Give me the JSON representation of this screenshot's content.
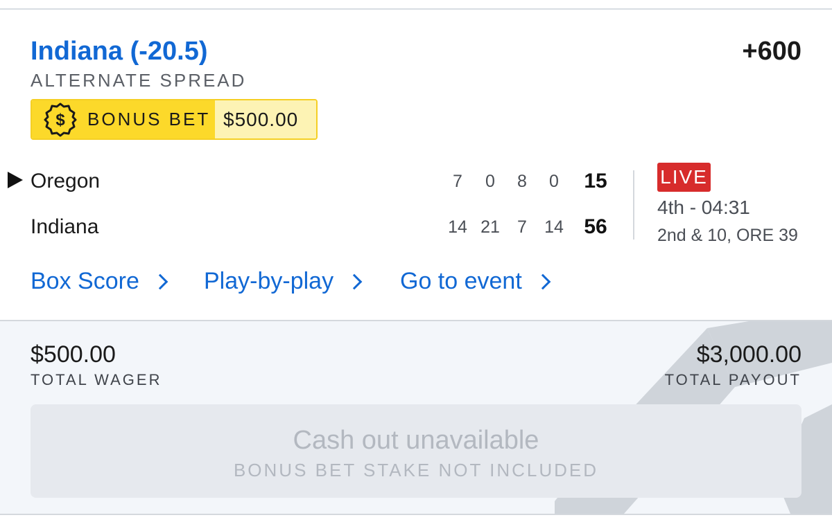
{
  "bet": {
    "selection": "Indiana (-20.5)",
    "odds": "+600",
    "market": "ALTERNATE SPREAD",
    "bonus_label": "BONUS BET",
    "bonus_amount": "$500.00"
  },
  "scoreboard": {
    "teams": [
      {
        "name": "Oregon",
        "quarters": [
          "7",
          "0",
          "8",
          "0"
        ],
        "total": "15"
      },
      {
        "name": "Indiana",
        "quarters": [
          "14",
          "21",
          "7",
          "14"
        ],
        "total": "56"
      }
    ],
    "status": {
      "live_label": "LIVE",
      "clock": "4th - 04:31",
      "situation": "2nd & 10, ORE 39"
    }
  },
  "links": {
    "box_score": "Box Score",
    "play_by_play": "Play-by-play",
    "go_to_event": "Go to event"
  },
  "summary": {
    "total_wager": "$500.00",
    "total_wager_label": "TOTAL WAGER",
    "total_payout": "$3,000.00",
    "total_payout_label": "TOTAL PAYOUT"
  },
  "cashout": {
    "title": "Cash out unavailable",
    "subtitle": "BONUS BET STAKE NOT INCLUDED"
  },
  "colors": {
    "accent_blue": "#1168d4",
    "live_red": "#d72c2c",
    "bonus_yellow": "#fcd92a"
  }
}
